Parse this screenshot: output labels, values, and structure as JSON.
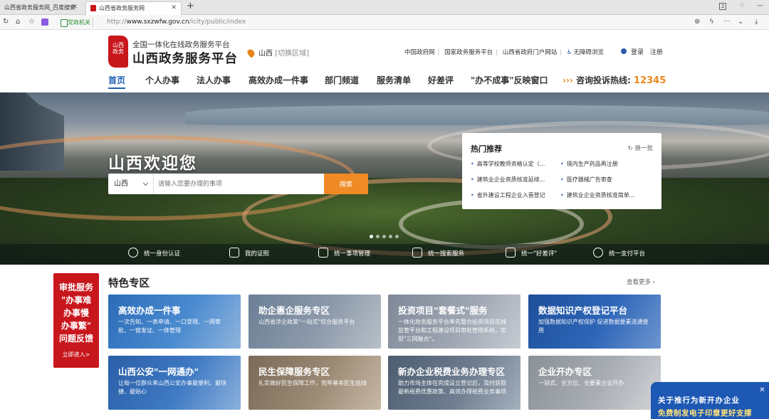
{
  "browser": {
    "tabs": [
      {
        "label": "山西省政务服务网_百度搜索"
      },
      {
        "label": "山西省政务服务网"
      }
    ],
    "new_tab": "+",
    "security_label": "党政机关",
    "url_prefix": "http://",
    "url_domain": "www.sxzwfw.gov.cn",
    "url_path": "/icity/public/index",
    "counter": "2"
  },
  "header": {
    "logo_text": "山西政务",
    "subtitle": "全国一体化在线政务服务平台",
    "title": "山西政务服务平台",
    "location": "山西",
    "switch_area": "[切换区域]",
    "links": [
      "中国政府网",
      "国家政务服务平台",
      "山西省政府门户网站",
      "无障碍浏览"
    ],
    "login": "登录",
    "register": "注册"
  },
  "menu": {
    "items": [
      "首页",
      "个人办事",
      "法人办事",
      "高效办成一件事",
      "部门频道",
      "服务清单",
      "好差评",
      "\"办不成事\"反映窗口"
    ],
    "hotline_label": "咨询投诉热线:",
    "hotline_number": "12345"
  },
  "banner": {
    "welcome": "山西欢迎您",
    "search": {
      "region": "山西",
      "placeholder": "请输入您要办理的事项",
      "button": "搜索"
    },
    "hot": {
      "title": "热门推荐",
      "refresh": "换一批",
      "items": [
        "高等学校教师资格认定（...",
        "境内生产药品再注册",
        "建筑业企业资质核准延续...",
        "医疗器械广告审查",
        "省外建设工程企业入晋登记",
        "建筑业企业资质核准简单..."
      ]
    },
    "tools": [
      "统一身份认证",
      "我的证照",
      "统一事项管理",
      "统一搜索服务",
      "统一\"好差评\"",
      "统一支付平台"
    ]
  },
  "feature": {
    "title": "特色专区",
    "more": "查看更多",
    "side": {
      "lines": [
        "审批服务",
        "\"办事难",
        "办事慢",
        "办事繁\"",
        "问题反馈"
      ],
      "enter": "立即进入>"
    },
    "cards": [
      {
        "title": "高效办成一件事",
        "desc": "一次告知、一表申请、一口受理、一网审批、一窗发证、一体管理"
      },
      {
        "title": "助企惠企服务专区",
        "desc": "山西省涉企政策\"一站式\"综合服务平台"
      },
      {
        "title": "投资项目\"套餐式\"服务",
        "desc": "一体化政务服务平台率先整合投资项目在线监管平台和工程建设项目审批管理系统，实现\"三网融合\"。"
      },
      {
        "title": "数据知识产权登记平台",
        "desc": "加强数据知识产权保护 促进数据要素流通使用"
      },
      {
        "title": "山西公安\"一网通办\"",
        "desc": "让每一位群众来山西公安办事最便利、最快捷、最贴心"
      },
      {
        "title": "民生保障服务专区",
        "desc": "扎实做好民生保障工作，兜牢基本民生底线"
      },
      {
        "title": "新办企业税费业务办理专区",
        "desc": "助力市场主体在完成设立登记后，及时获取最新税费优惠政策、高效办理税费业务事项"
      },
      {
        "title": "企业开办专区",
        "desc": "一站式、全方位、全要素企业开办"
      }
    ]
  },
  "notice": {
    "line1": "关于推行为新开办企业",
    "line2": "免费制发电子印章更好支撑",
    "close": "✕"
  }
}
